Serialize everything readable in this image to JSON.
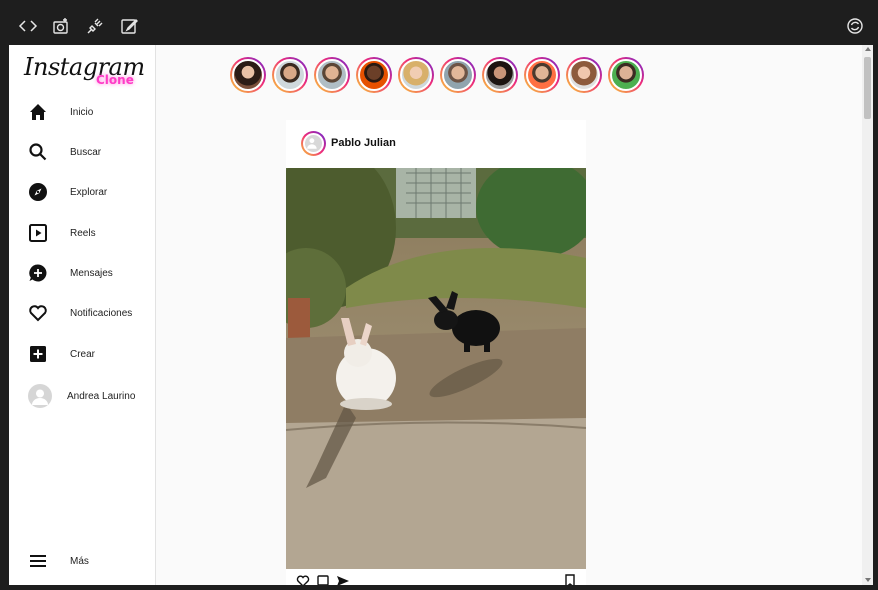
{
  "topbar": {
    "icons": [
      "code-icon",
      "camera-icon",
      "plug-icon",
      "edit-icon",
      "refresh-icon"
    ]
  },
  "logo": {
    "main": "Instagram",
    "sub": "Clone"
  },
  "sidebar": {
    "items": [
      {
        "label": "Inicio",
        "icon": "home-icon"
      },
      {
        "label": "Buscar",
        "icon": "search-icon"
      },
      {
        "label": "Explorar",
        "icon": "compass-icon"
      },
      {
        "label": "Reels",
        "icon": "reels-icon"
      },
      {
        "label": "Mensajes",
        "icon": "message-icon"
      },
      {
        "label": "Notificaciones",
        "icon": "heart-icon"
      },
      {
        "label": "Crear",
        "icon": "plus-square-icon"
      },
      {
        "label": "Andrea Laurino",
        "icon": "avatar-icon"
      }
    ],
    "more": {
      "label": "Más",
      "icon": "menu-icon"
    }
  },
  "stories": {
    "count": 10
  },
  "post": {
    "username": "Pablo Julian",
    "actions": [
      "heart-icon",
      "comment-icon",
      "share-icon",
      "bookmark-icon"
    ]
  },
  "colors": {
    "accent_pink": "#ff3cc7",
    "story_gradient_start": "#f9ce34",
    "story_gradient_mid": "#ee2a7b",
    "story_gradient_end": "#6228d7"
  }
}
